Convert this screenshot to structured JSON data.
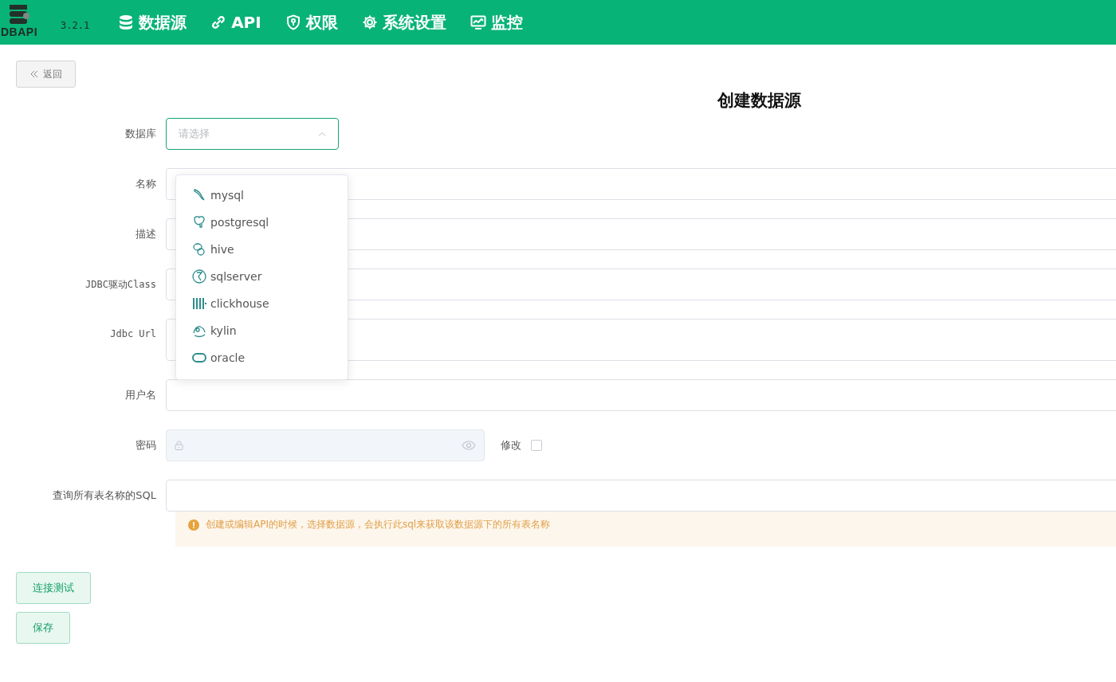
{
  "header": {
    "logo_text": "DBAPI",
    "version": "3.2.1",
    "nav": [
      {
        "label": "数据源",
        "kind": "database"
      },
      {
        "label": "API",
        "kind": "link"
      },
      {
        "label": "权限",
        "kind": "shield"
      },
      {
        "label": "系统设置",
        "kind": "gear"
      },
      {
        "label": "监控",
        "kind": "monitor"
      }
    ]
  },
  "back_button": "返回",
  "title": "创建数据源",
  "form": {
    "fields": [
      {
        "label": "数据库",
        "kind": "select",
        "placeholder": "请选择",
        "expanded": true,
        "mono": false
      },
      {
        "label": "名称",
        "kind": "input",
        "mono": false
      },
      {
        "label": "描述",
        "kind": "input",
        "mono": false
      },
      {
        "label": "JDBC驱动Class",
        "kind": "input",
        "mono": true
      },
      {
        "label": "Jdbc Url",
        "kind": "textarea",
        "mono": true
      },
      {
        "label": "用户名",
        "kind": "input",
        "mono": false
      },
      {
        "label": "密码",
        "kind": "password",
        "disabled": true,
        "mono": false,
        "modify": {
          "label": "修改",
          "checked": false
        }
      },
      {
        "label": "查询所有表名称的SQL",
        "kind": "input",
        "mono": false
      }
    ],
    "hint": "创建或编辑API的时候，选择数据源，会执行此sql来获取该数据源下的所有表名称"
  },
  "dropdown": {
    "options": [
      {
        "label": "mysql"
      },
      {
        "label": "postgresql"
      },
      {
        "label": "hive"
      },
      {
        "label": "sqlserver"
      },
      {
        "label": "clickhouse"
      },
      {
        "label": "kylin"
      },
      {
        "label": "oracle"
      }
    ]
  },
  "buttons": [
    "连接测试",
    "保存"
  ]
}
